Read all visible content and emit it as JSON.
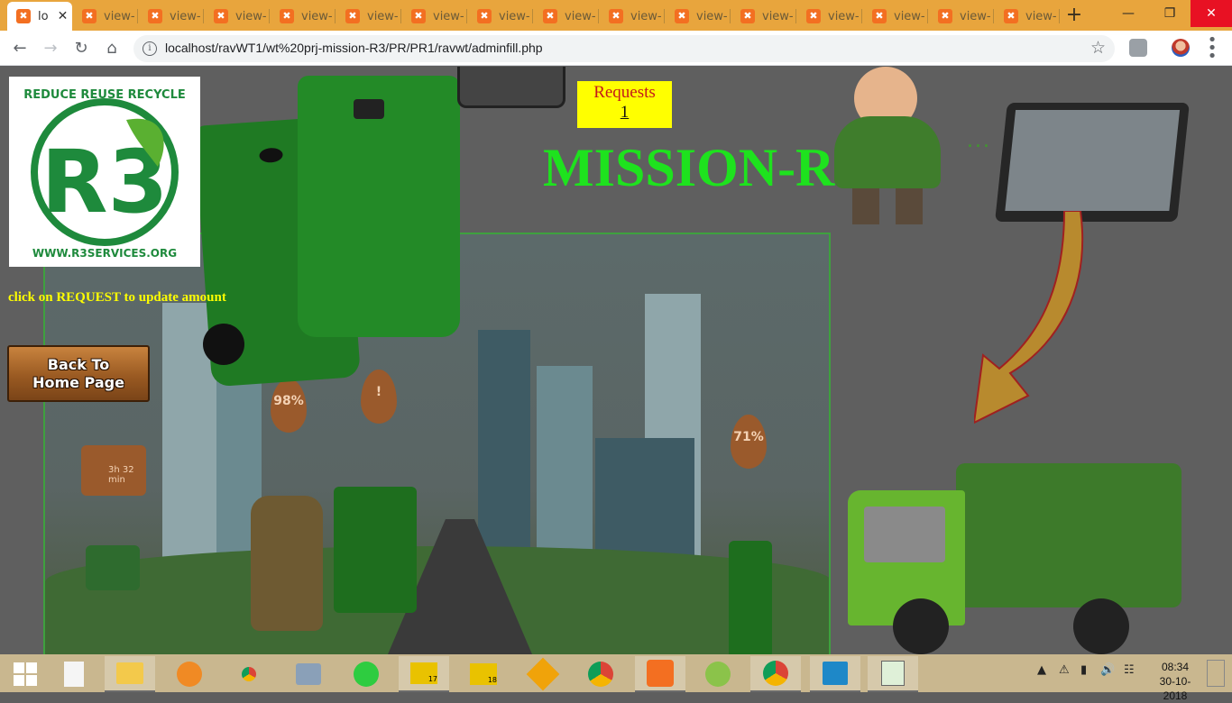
{
  "browser": {
    "tabs": [
      {
        "label": "lo",
        "active": true
      },
      {
        "label": "view-"
      },
      {
        "label": "view-"
      },
      {
        "label": "view-"
      },
      {
        "label": "view-"
      },
      {
        "label": "view-"
      },
      {
        "label": "view-"
      },
      {
        "label": "view-"
      },
      {
        "label": "view-"
      },
      {
        "label": "view-"
      },
      {
        "label": "view-"
      },
      {
        "label": "view-"
      },
      {
        "label": "view-"
      },
      {
        "label": "view-"
      },
      {
        "label": "view-"
      },
      {
        "label": "view-"
      }
    ],
    "new_tab": "+",
    "url": "localhost/ravWT1/wt%20prj-mission-R3/PR/PR1/ravwt/adminfill.php"
  },
  "page": {
    "requests_label": "Requests",
    "requests_count": "1",
    "title": "MISSION-R3",
    "instruction": "click on REQUEST to update amount",
    "back_line1": "Back To",
    "back_line2": "Home Page",
    "logo_arc": "REDUCE REUSE RECYCLE",
    "logo_mark": "R3",
    "logo_site": "WWW.R3SERVICES.ORG",
    "scene_badges": {
      "pct1": "98%",
      "alert": "!",
      "pct2": "71%",
      "timer": "3h 32 min"
    }
  },
  "taskbar": {
    "time": "08:34",
    "date": "30-10-2018",
    "apps": [
      "file-icon",
      "file-explorer-icon",
      "uc-browser-icon",
      "chrome-icon",
      "monitor-app-icon",
      "sync-app-icon",
      "labview-17-icon",
      "labview-18-icon",
      "vs-code-icon",
      "chrome-icon",
      "xampp-icon",
      "android-icon",
      "chrome-active-icon",
      "photos-icon",
      "notepad-icon"
    ],
    "labview17": "17",
    "labview18": "18"
  },
  "colors": {
    "tabbar": "#e8a53d",
    "title_green": "#1ee21e",
    "note_yellow": "#ffff00",
    "requests_bg": "#ffff00",
    "requests_text": "#c41a1a"
  }
}
